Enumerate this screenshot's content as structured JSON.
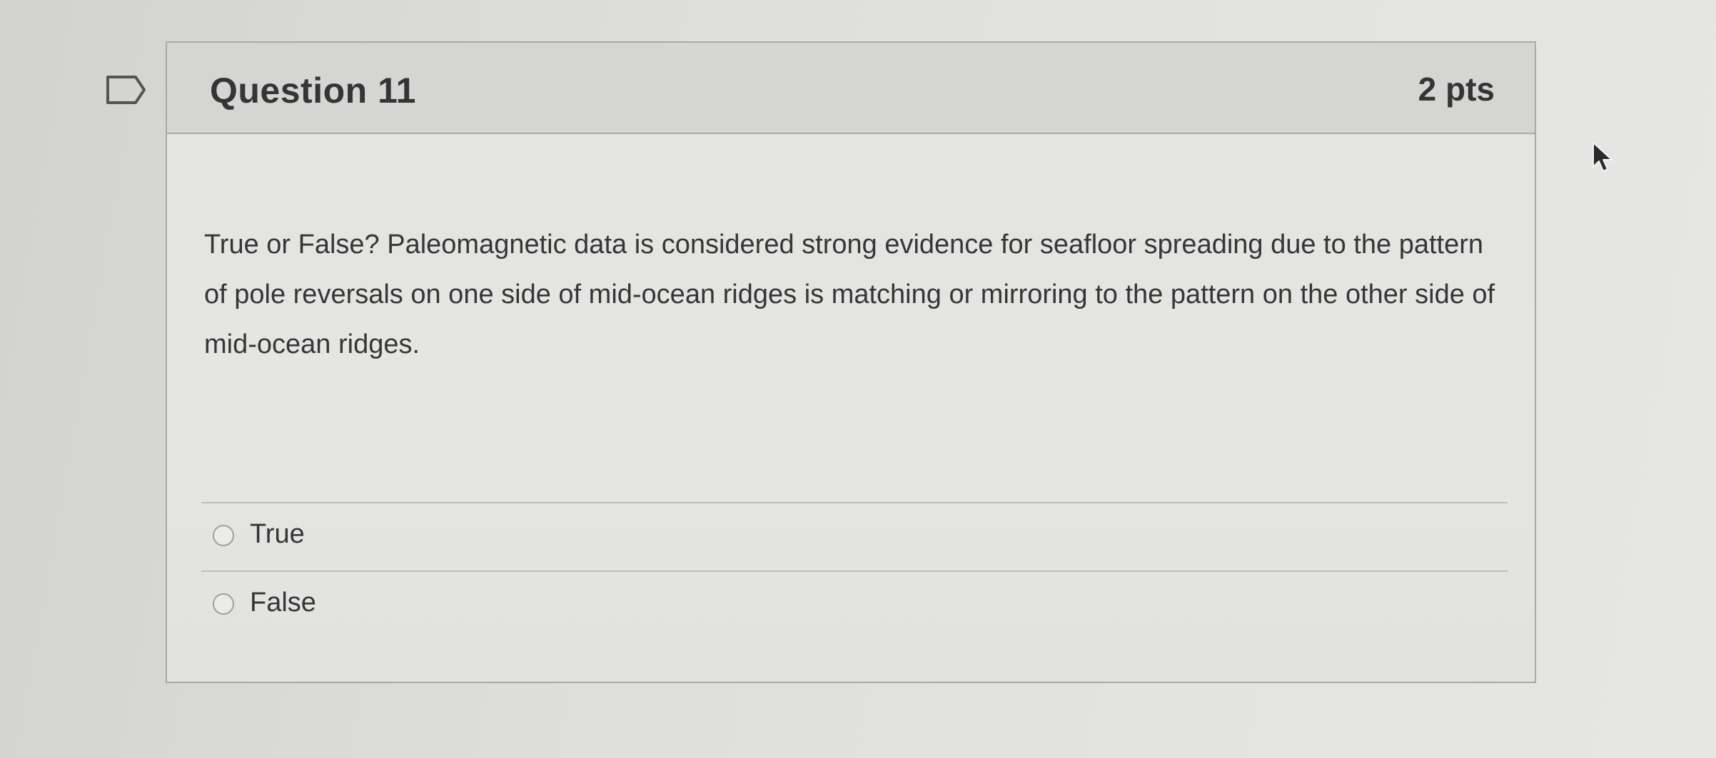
{
  "question": {
    "flag_icon": "flag-icon",
    "title": "Question 11",
    "points": "2 pts",
    "text": "True or False? Paleomagnetic data is considered strong evidence for seafloor spreading due to the pattern of pole reversals on one side of mid-ocean ridges is matching or mirroring to the pattern on the other side of mid-ocean ridges.",
    "answers": [
      {
        "label": "True",
        "selected": false
      },
      {
        "label": "False",
        "selected": false
      }
    ]
  },
  "cursor_icon": "mouse-pointer-icon"
}
